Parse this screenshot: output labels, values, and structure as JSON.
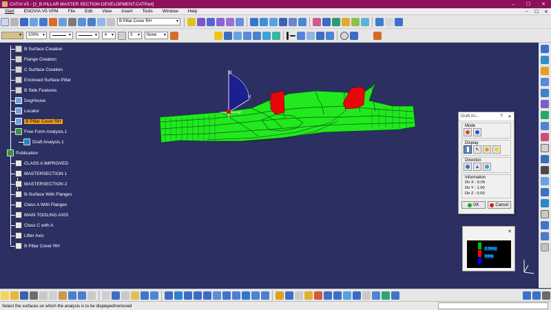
{
  "window": {
    "title": "CATIA V5 - [2_B PILLAR MASTER SECTION DEVELOPMENT.CATPart]",
    "minimize": "–",
    "maximize": "☐",
    "close": "✕"
  },
  "menu": {
    "items": [
      "Start",
      "ENOVIA V5 VPM",
      "File",
      "Edit",
      "View",
      "Insert",
      "Tools",
      "Window",
      "Help"
    ]
  },
  "toolbar": {
    "current_part": "B Pillar Cover RH",
    "transparency": "100%",
    "layer_number": "3",
    "layer_filter": "None"
  },
  "tree": {
    "items": [
      {
        "label": "B Surface Creation",
        "icon": "geometric-set-icon"
      },
      {
        "label": "Flange Creation",
        "icon": "geometric-set-icon"
      },
      {
        "label": "C Surface Creation",
        "icon": "geometric-set-icon"
      },
      {
        "label": "Enclosed Surface Pillar",
        "icon": "geometric-set-icon"
      },
      {
        "label": "B Side Features",
        "icon": "geometric-set-icon"
      },
      {
        "label": "DogHouse",
        "icon": "part-body-icon"
      },
      {
        "label": "Locator",
        "icon": "part-body-icon"
      },
      {
        "label": "B Pillar Cover RH",
        "icon": "part-body-icon",
        "selected": true
      },
      {
        "label": "Free Form Analysis.1",
        "icon": "analysis-set-icon"
      },
      {
        "label": "Draft Analysis.1",
        "icon": "draft-analysis-icon"
      },
      {
        "label": "Publication",
        "icon": "publication-icon"
      },
      {
        "label": "CLASS A IMPROVED",
        "icon": "publication-item-icon"
      },
      {
        "label": "MASTERSECTION 1",
        "icon": "publication-item-icon"
      },
      {
        "label": "MASTERSECTION 2",
        "icon": "publication-item-icon"
      },
      {
        "label": "B-Surface With Flanges",
        "icon": "publication-item-icon"
      },
      {
        "label": "Class A With Flanges",
        "icon": "publication-item-icon"
      },
      {
        "label": "MAIN TOOLING AXIS",
        "icon": "publication-item-icon"
      },
      {
        "label": "Class C with A",
        "icon": "publication-item-icon"
      },
      {
        "label": "Lifter Axis",
        "icon": "publication-item-icon"
      },
      {
        "label": "B Pillar Cover RH",
        "icon": "publication-item-icon"
      }
    ]
  },
  "draft_dialog": {
    "title": "Draft An...",
    "help": "?",
    "close": "✕",
    "mode_label": "Mode",
    "display_label": "Display",
    "direction_label": "Direction",
    "information_label": "Information",
    "dir_x": "Dir X : 0.09",
    "dir_y": "Dir Y : 1.00",
    "dir_z": "Dir Z :  0.00",
    "ok": "OK",
    "cancel": "Cancel"
  },
  "color_scale": {
    "close": "✕",
    "value_top": "2.5deg",
    "value_bottom": "0deg",
    "colors": [
      "#00c000",
      "#ff0000",
      "#0000ff"
    ]
  },
  "viewport": {
    "background": "#2c2f62",
    "compass_labels": [
      "W",
      "U",
      "V"
    ]
  },
  "status": {
    "message": "Select the surfaces on which the analysis is to be displayed/removed"
  },
  "colors": {
    "title_bar": "#8e0f5c",
    "part_green": "#22e81e",
    "part_red": "#e8060a",
    "selection_orange": "#f0a020"
  }
}
